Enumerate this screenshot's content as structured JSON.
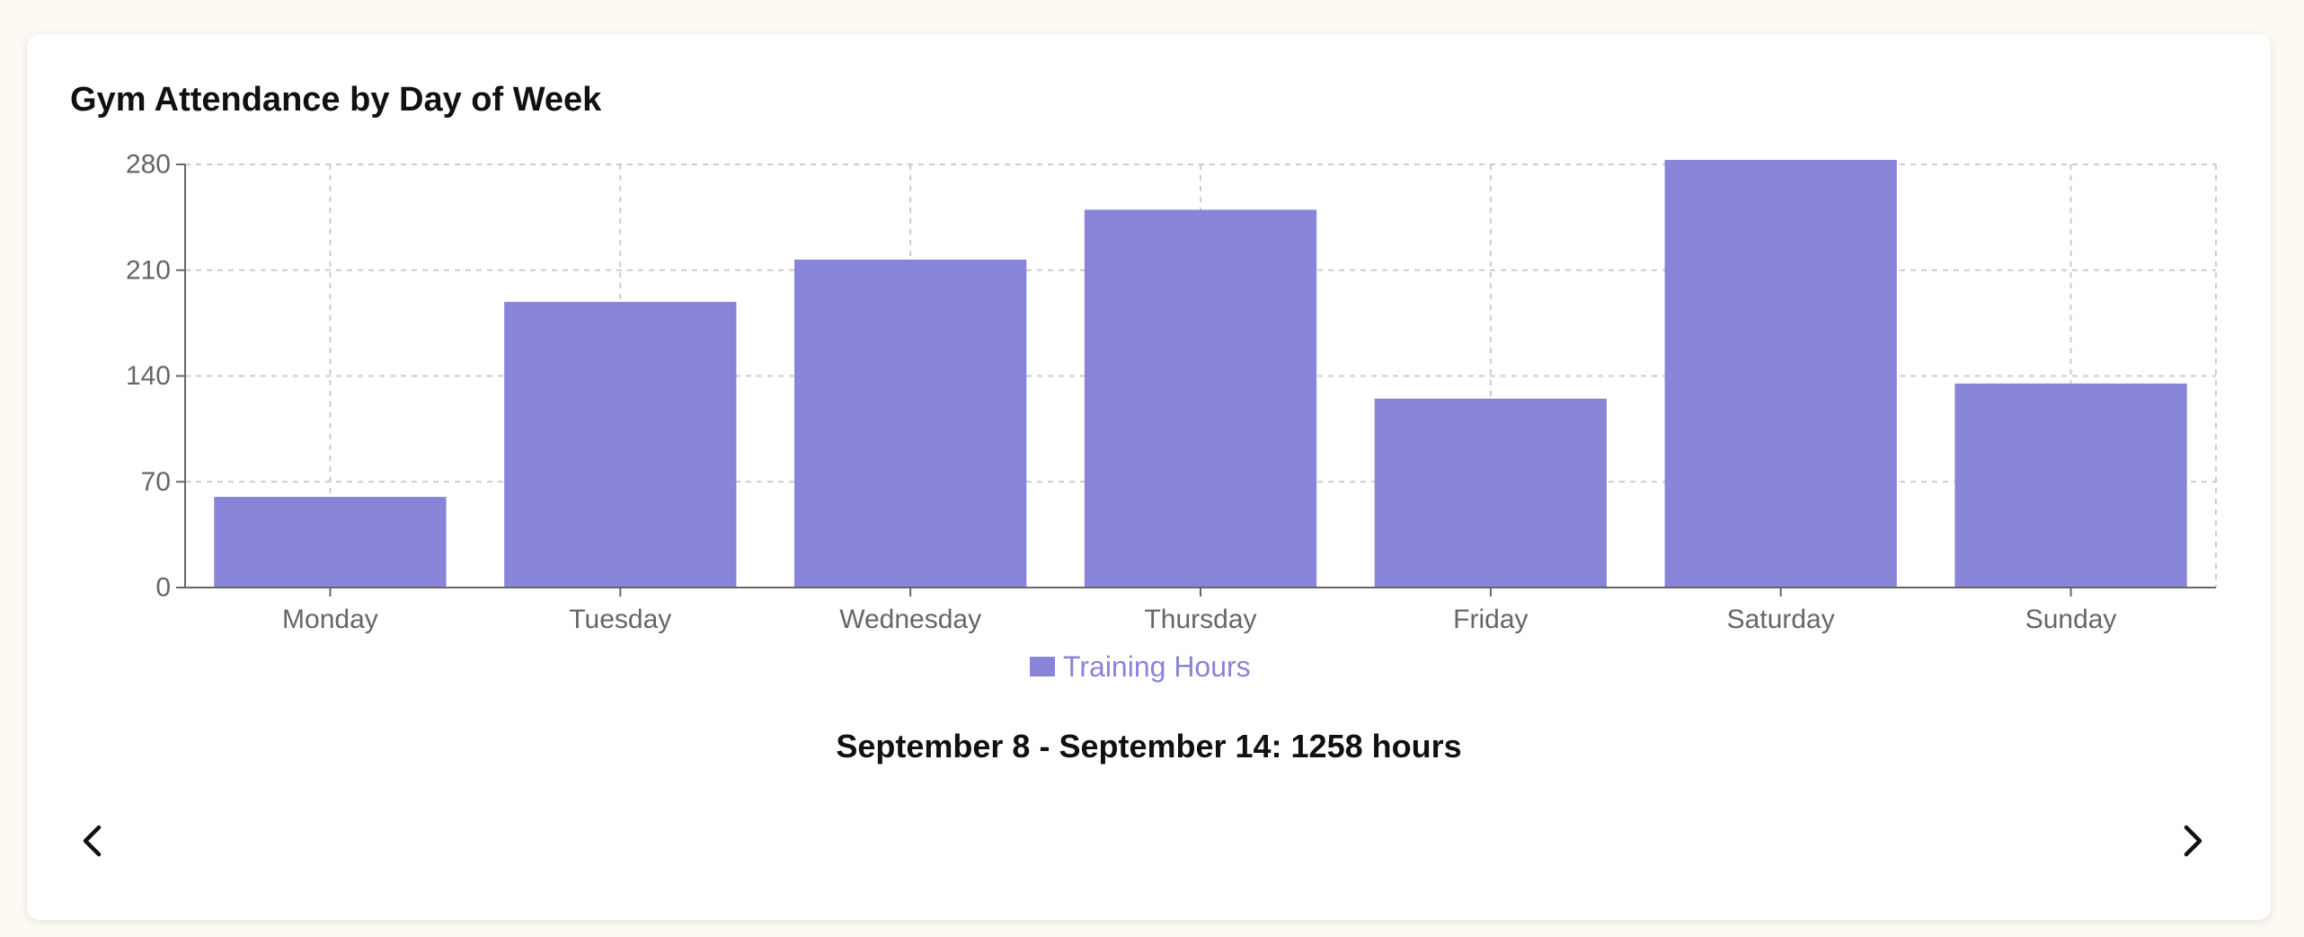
{
  "chart_data": {
    "type": "bar",
    "title": "Gym Attendance by Day of Week",
    "categories": [
      "Monday",
      "Tuesday",
      "Wednesday",
      "Thursday",
      "Friday",
      "Saturday",
      "Sunday"
    ],
    "series": [
      {
        "name": "Training Hours",
        "values": [
          60,
          189,
          217,
          250,
          125,
          283,
          135
        ],
        "color": "#8884d8"
      }
    ],
    "yticks": [
      "0",
      "70",
      "140",
      "210",
      "280"
    ],
    "ylim": [
      0,
      280
    ],
    "grid": true,
    "legend_position": "bottom-center"
  },
  "summary": {
    "text": "September 8 - September 14: 1258 hours"
  },
  "navigation": {
    "prev_icon": "chevron-left-icon",
    "next_icon": "chevron-right-icon"
  }
}
